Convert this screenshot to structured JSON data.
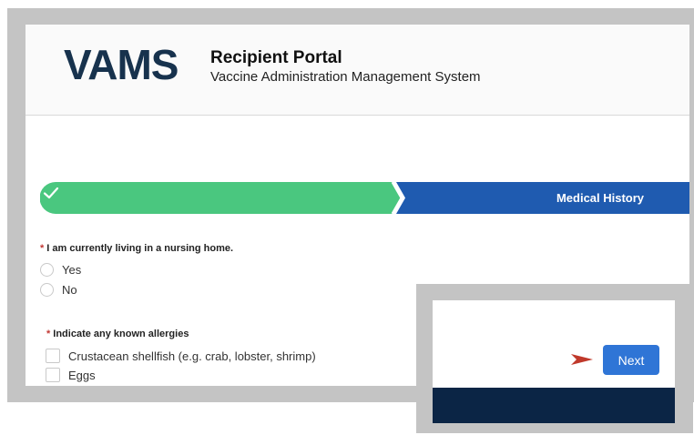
{
  "header": {
    "logo_text": "VAMS",
    "title": "Recipient Portal",
    "subtitle": "Vaccine Administration Management System"
  },
  "progress": {
    "completed_step_icon": "check-icon",
    "current_step_label": "Medical History",
    "completed_color": "#4ac77f",
    "current_color": "#1f5bb0"
  },
  "questions": {
    "nursing_home": {
      "required_mark": "*",
      "label": "I am currently living in a nursing home.",
      "options": [
        "Yes",
        "No"
      ]
    },
    "allergies": {
      "required_mark": "*",
      "label": "Indicate any known allergies",
      "options": [
        "Crustacean shellfish (e.g. crab, lobster, shrimp)",
        "Eggs"
      ]
    }
  },
  "inset": {
    "next_label": "Next",
    "arrow_icon": "arrow-right-icon",
    "arrow_color": "#c0392b",
    "footer_color": "#0b2545"
  }
}
